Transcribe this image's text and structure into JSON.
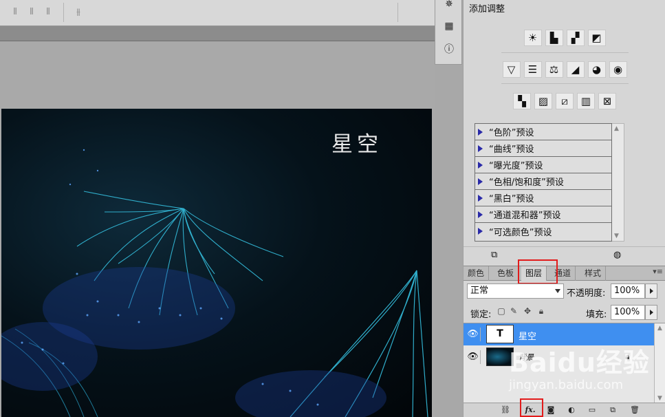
{
  "document": {
    "title_text": "星空"
  },
  "adjustments": {
    "title": "添加调整",
    "presets": [
      "“色阶”预设",
      "“曲线”预设",
      "“曝光度”预设",
      "“色相/饱和度”预设",
      "“黑白”预设",
      "“通道混和器”预设",
      "“可选颜色”预设"
    ]
  },
  "layers_panel": {
    "tabs": [
      "颜色",
      "色板",
      "图层",
      "通道",
      "样式"
    ],
    "active_tab": "图层",
    "blend_mode": "正常",
    "opacity_label": "不透明度:",
    "opacity_value": "100%",
    "lock_label": "锁定:",
    "fill_label": "填充:",
    "fill_value": "100%",
    "layers": [
      {
        "name": "星空",
        "thumb_glyph": "T",
        "selected": true
      },
      {
        "name": "背景",
        "locked": true
      }
    ],
    "footer_fx": "fx."
  },
  "watermark": {
    "main": "Baidu经验",
    "sub": "jingyan.baidu.com"
  },
  "highlight_color": "#e21b1b",
  "selection_color": "#3f8ff0"
}
